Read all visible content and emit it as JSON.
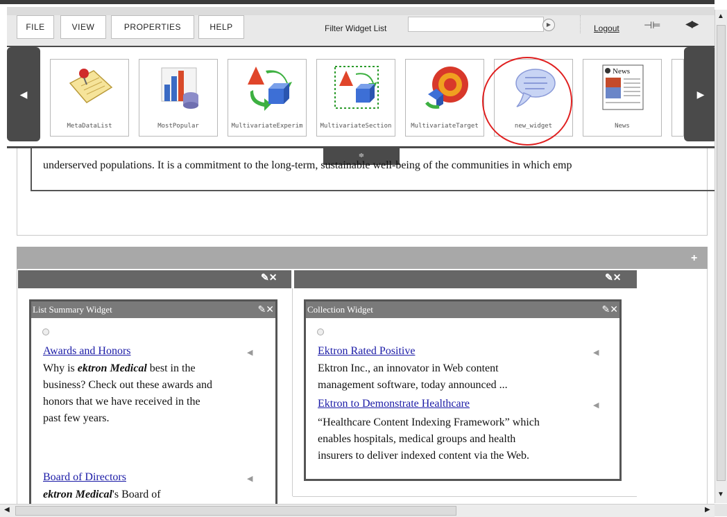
{
  "menu": {
    "file": "FILE",
    "view": "VIEW",
    "properties": "PROPERTIES",
    "help": "HELP",
    "filter_label": "Filter Widget List",
    "filter_value": "",
    "logout": "Logout"
  },
  "tray": {
    "handle_glyph": "≑",
    "widgets": [
      {
        "label": "MetaDataList",
        "icon": "note-pin-icon"
      },
      {
        "label": "MostPopular",
        "icon": "bar-chart-database-icon"
      },
      {
        "label": "MultivariateExperim",
        "icon": "shapes-cycle-icon"
      },
      {
        "label": "MultivariateSection",
        "icon": "shapes-cycle-selected-icon"
      },
      {
        "label": "MultivariateTarget",
        "icon": "target-icon"
      },
      {
        "label": "new_widget",
        "icon": "speech-bubble-icon"
      },
      {
        "label": "News",
        "icon": "newspaper-icon"
      }
    ],
    "highlight_color": "#e02020"
  },
  "content": {
    "body_line": "underserved populations.  It is a commitment to the long-term, sustainable well-being of the communities in which emp"
  },
  "zone": {
    "add_glyph": "+"
  },
  "list_widget": {
    "title": "List Summary Widget",
    "items": [
      {
        "link": "Awards and Honors",
        "lines": [
          "Why is ",
          "ektron Medical",
          "  best in the",
          "business? Check out these awards and",
          "honors that we have received in the",
          "past few years."
        ]
      },
      {
        "link": "Board of Directors",
        "lines": [
          "ektron Medical",
          "'s Board of"
        ]
      }
    ]
  },
  "collection_widget": {
    "title": "Collection Widget",
    "items": [
      {
        "link": "Ektron Rated Positive",
        "lines": [
          "Ektron Inc., an innovator in Web content",
          "management software, today announced ..."
        ]
      },
      {
        "link": "Ektron to Demonstrate Healthcare",
        "lines": [
          "“Healthcare Content Indexing Framework” which",
          "enables hospitals, medical groups and health",
          "insurers to deliver indexed content via the Web."
        ]
      }
    ]
  },
  "colors": {
    "link": "#1a1aa6",
    "dark_bar": "#4a4a4a",
    "widget_bar": "#7a7a7a"
  }
}
